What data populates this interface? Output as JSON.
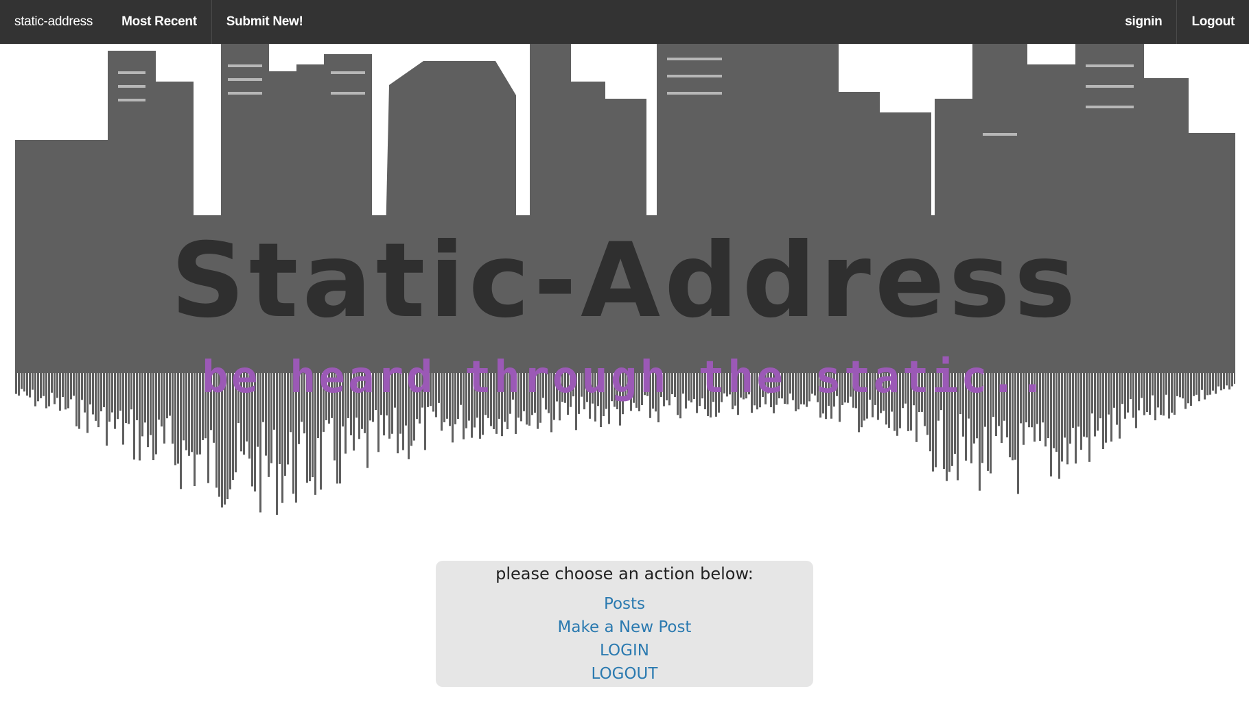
{
  "navbar": {
    "brand": "static-address",
    "left_items": [
      {
        "label": "Most Recent"
      },
      {
        "label": "Submit New!"
      }
    ],
    "right_items": [
      {
        "label": "signin"
      },
      {
        "label": "Logout"
      }
    ]
  },
  "hero": {
    "title": "Static-Address",
    "tagline": "be heard through the static..",
    "colors": {
      "skyline": "#5f5f5f",
      "title": "#2f2f2f",
      "tagline": "#9b59b6"
    }
  },
  "actions": {
    "prompt": "please choose an action below:",
    "links": [
      {
        "label": "Posts"
      },
      {
        "label": "Make a New Post"
      },
      {
        "label": "LOGIN"
      },
      {
        "label": "LOGOUT"
      }
    ],
    "link_color": "#2b7ab0"
  }
}
